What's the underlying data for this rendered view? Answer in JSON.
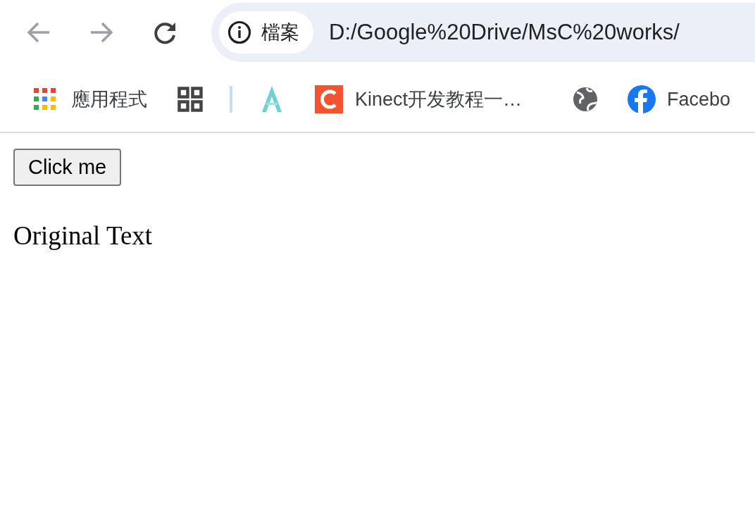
{
  "toolbar": {
    "security_chip": "檔案",
    "url": "D:/Google%20Drive/MsC%20works/"
  },
  "bookmarks": [
    {
      "kind": "apps",
      "label": "應用程式"
    },
    {
      "kind": "grid"
    },
    {
      "kind": "separator"
    },
    {
      "kind": "a-logo"
    },
    {
      "kind": "c-logo",
      "label": "Kinect开发教程一…"
    },
    {
      "kind": "globe"
    },
    {
      "kind": "f-logo",
      "label": "Facebo"
    }
  ],
  "page": {
    "button": "Click me",
    "text": "Original Text"
  }
}
